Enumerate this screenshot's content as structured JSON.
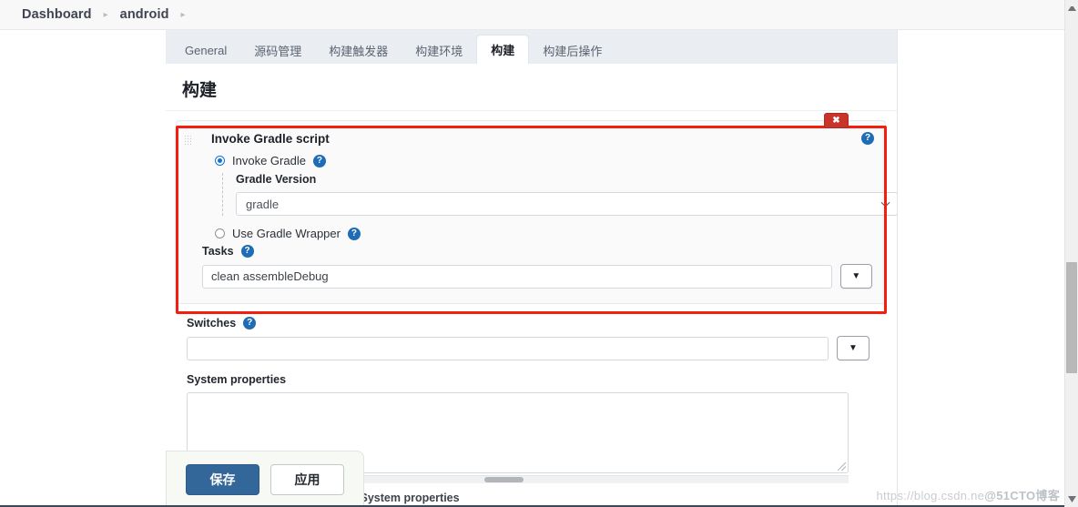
{
  "breadcrumb": {
    "items": [
      "Dashboard",
      "android"
    ],
    "separator": "▸"
  },
  "tabs": [
    {
      "label": "General",
      "active": false
    },
    {
      "label": "源码管理",
      "active": false
    },
    {
      "label": "构建触发器",
      "active": false
    },
    {
      "label": "构建环境",
      "active": false
    },
    {
      "label": "构建",
      "active": true
    },
    {
      "label": "构建后操作",
      "active": false
    }
  ],
  "panel": {
    "title": "构建"
  },
  "builder": {
    "heading": "Invoke Gradle script",
    "delete_label": "✖",
    "help_label": "?",
    "invoke_gradle": {
      "label": "Invoke Gradle",
      "selected": true
    },
    "gradle_version": {
      "label": "Gradle Version",
      "value": "gradle"
    },
    "use_wrapper": {
      "label": "Use Gradle Wrapper",
      "selected": false
    },
    "tasks": {
      "label": "Tasks",
      "value": "clean assembleDebug",
      "placeholder": "",
      "dropdown_glyph": "▼"
    }
  },
  "switches": {
    "label": "Switches",
    "value": "",
    "placeholder": "",
    "dropdown_glyph": "▼"
  },
  "system_properties": {
    "label": "System properties",
    "value": "",
    "placeholder": ""
  },
  "pass_params": {
    "label": "Pass all job parameters as System properties",
    "checked": false
  },
  "actions": {
    "save_label": "保存",
    "apply_label": "应用"
  },
  "watermark": {
    "url_text": "https://blog.csdn.ne",
    "tag_text": "@51CTO博客"
  },
  "colors": {
    "accent_blue": "#336699",
    "highlight_red": "#f41d0e",
    "help_blue": "#1e6cb5",
    "delete_red": "#c9342a",
    "radio_blue": "#1273d4"
  }
}
